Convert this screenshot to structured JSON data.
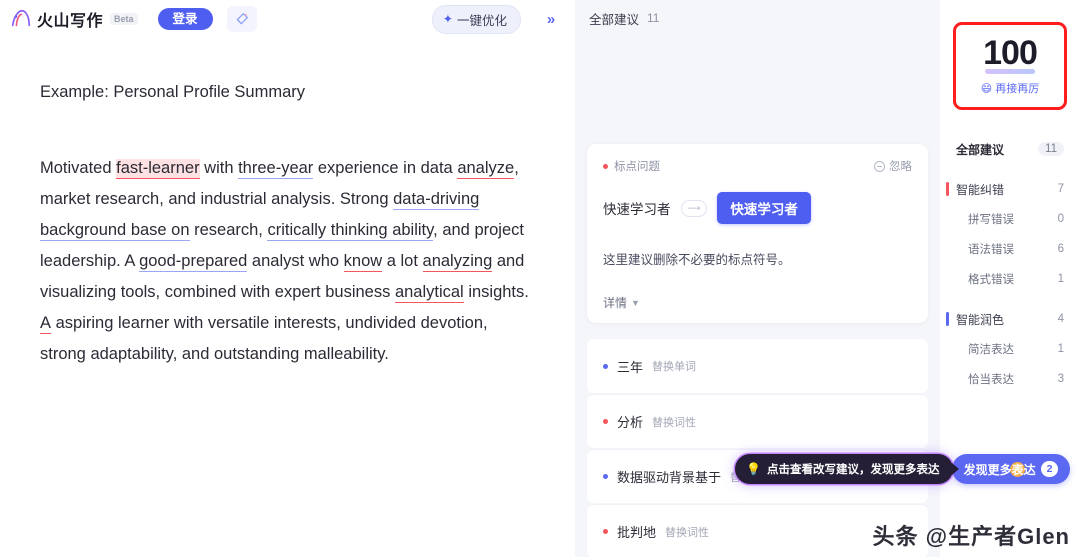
{
  "header": {
    "brand_name": "火山写作",
    "beta_badge": "Beta",
    "login_label": "登录",
    "magic_icon": "magic-wand-icon",
    "optimize_label": "一键优化",
    "optimize_icon": "sparkle-icon",
    "collapse_label": "»"
  },
  "editor": {
    "title": "Example: Personal Profile Summary",
    "paragraph": [
      {
        "t": "Motivated ",
        "s": "plain"
      },
      {
        "t": "fast-learner",
        "s": "red-hl"
      },
      {
        "t": " with ",
        "s": "plain"
      },
      {
        "t": "three-year",
        "s": "blue"
      },
      {
        "t": " experience in data ",
        "s": "plain"
      },
      {
        "t": "analyze",
        "s": "red"
      },
      {
        "t": ", market research, and industrial analysis. Strong ",
        "s": "plain"
      },
      {
        "t": "data-driving background base on",
        "s": "blue"
      },
      {
        "t": " research, ",
        "s": "plain"
      },
      {
        "t": "critically thinking ability",
        "s": "blue"
      },
      {
        "t": ", and project leadership. A ",
        "s": "plain"
      },
      {
        "t": "good-prepared",
        "s": "blue"
      },
      {
        "t": " analyst who ",
        "s": "plain"
      },
      {
        "t": "know",
        "s": "red"
      },
      {
        "t": " a lot ",
        "s": "plain"
      },
      {
        "t": "analyzing",
        "s": "red"
      },
      {
        "t": " and visualizing tools, combined with expert business ",
        "s": "plain"
      },
      {
        "t": "analytical",
        "s": "red"
      },
      {
        "t": " insights. ",
        "s": "plain"
      },
      {
        "t": "A",
        "s": "red"
      },
      {
        "t": " aspiring learner with versatile interests, undivided devotion, strong adaptability, and outstanding malleability.",
        "s": "plain"
      }
    ]
  },
  "suggestions": {
    "header_label": "全部建议",
    "header_count": "11",
    "card": {
      "tag_label": "标点问题",
      "tag_color": "#f5555d",
      "ignore_label": "忽略",
      "ignore_icon": "minus-circle-icon",
      "original_word": "快速学习者",
      "arrow_icon": "arrow-right-icon",
      "replacement_word": "快速学习者",
      "description": "这里建议删除不必要的标点符号。",
      "more_label": "详情",
      "more_icon": "chevron-down-icon"
    },
    "rows": [
      {
        "word": "三年",
        "kind": "替换单词",
        "dot": "blue"
      },
      {
        "word": "分析",
        "kind": "替换词性",
        "dot": "red"
      },
      {
        "word": "数据驱动背景基于",
        "kind": "替换",
        "dot": "blue"
      },
      {
        "word": "批判地",
        "kind": "替换词性",
        "dot": "red"
      }
    ],
    "tooltip": {
      "icon": "lightbulb-icon",
      "text": "点击查看改写建议，发现更多表达"
    }
  },
  "stats": {
    "score": {
      "value": "100",
      "emoji": "😄",
      "label": "再接再厉"
    },
    "all": {
      "label": "全部建议",
      "count": "11"
    },
    "groups": [
      {
        "label": "智能纠错",
        "count": "7",
        "bar": "red",
        "items": [
          {
            "label": "拼写错误",
            "count": "0"
          },
          {
            "label": "语法错误",
            "count": "6"
          },
          {
            "label": "格式错误",
            "count": "1"
          }
        ]
      },
      {
        "label": "智能润色",
        "count": "4",
        "bar": "blue",
        "items": [
          {
            "label": "简洁表达",
            "count": "1"
          },
          {
            "label": "恰当表达",
            "count": "3"
          }
        ]
      }
    ],
    "discover": {
      "label": "发现更多表达",
      "count": "2"
    }
  },
  "watermark": {
    "text": "头条 @生产者Glen"
  },
  "colors": {
    "accent": "#5b68f2",
    "error": "#f5555d",
    "score_border": "#ff1d1d",
    "panel_bg": "#f5f6fa"
  }
}
